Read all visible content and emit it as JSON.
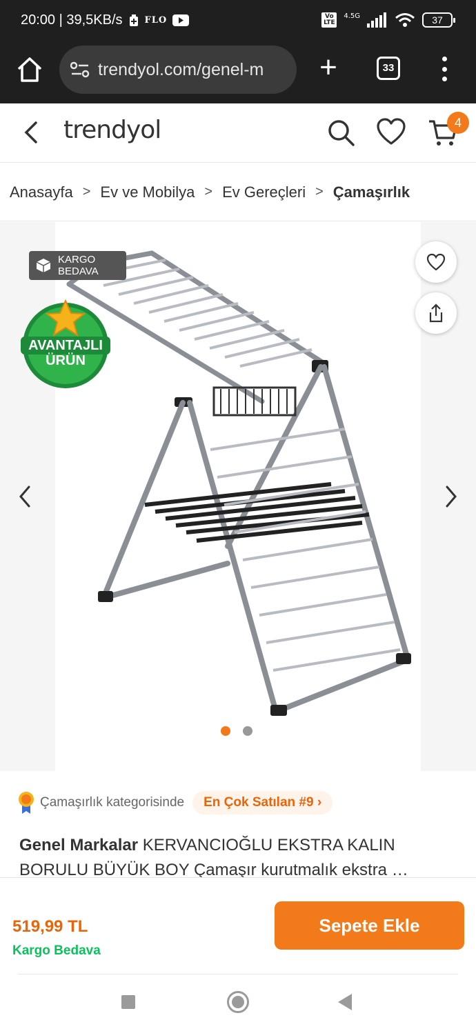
{
  "status_bar": {
    "time_speed": "20:00 | 39,5KB/s",
    "app_label": "FLO",
    "network": "4.5G",
    "volte": "Vo LTE",
    "battery": "37"
  },
  "browser": {
    "url": "trendyol.com/genel-m",
    "tab_count": "33"
  },
  "header": {
    "logo": "trendyol",
    "cart_count": "4"
  },
  "breadcrumb": {
    "items": [
      "Anasayfa",
      "Ev ve Mobilya",
      "Ev Gereçleri"
    ],
    "current": "Çamaşırlık"
  },
  "gallery": {
    "kargo_badge_line1": "KARGO",
    "kargo_badge_line2": "BEDAVA",
    "avantaj_line1": "AVANTAJLI",
    "avantaj_line2": "ÜRÜN",
    "active_dot_index": 0,
    "dot_count": 2
  },
  "product": {
    "category_text": "Çamaşırlık kategorisinde",
    "best_seller": "En Çok Satılan #9",
    "brand": "Genel Markalar",
    "name": "KERVANCIOĞLU EKSTRA KALIN BORULU BÜYÜK BOY Çamaşır kurutmalık ekstra …",
    "price": "519,99 TL",
    "shipping": "Kargo Bedava",
    "add_to_cart": "Sepete Ekle"
  },
  "colors": {
    "accent": "#f27a1a",
    "success": "#0bc15c"
  }
}
